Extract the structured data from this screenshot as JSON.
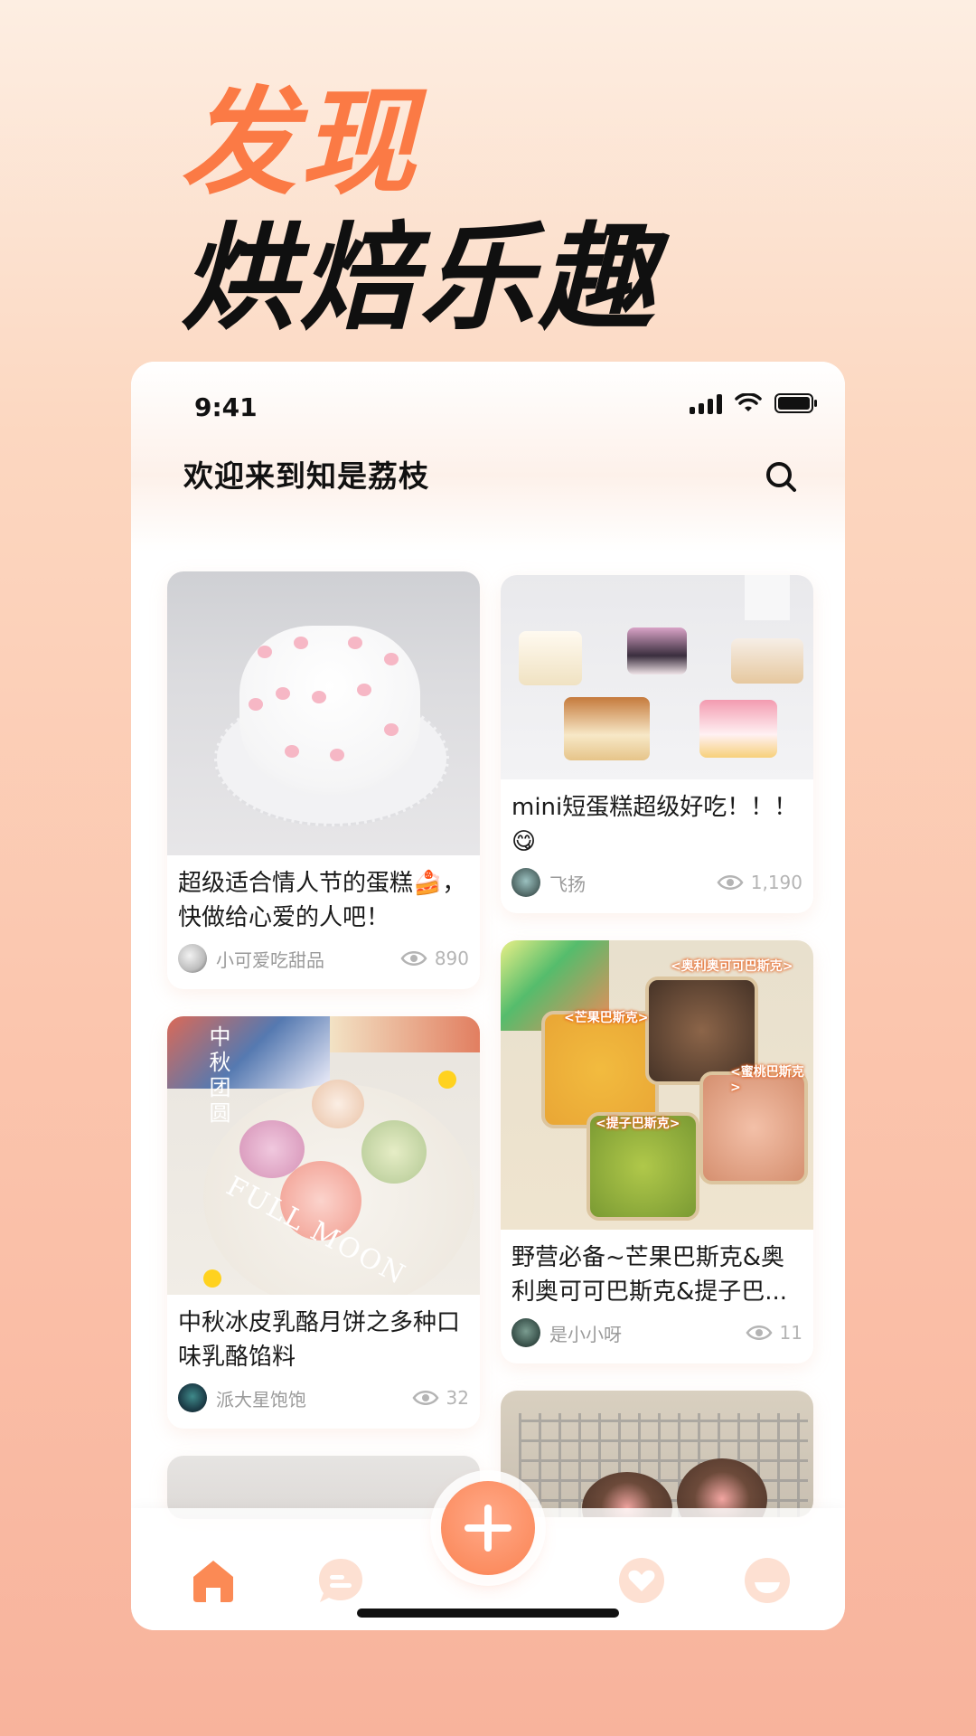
{
  "hero": {
    "line1": "发现",
    "line2": "烘焙乐趣"
  },
  "status_bar": {
    "time": "9:41"
  },
  "header": {
    "title": "欢迎来到知是荔枝",
    "search_icon": "search-icon"
  },
  "feed": {
    "left": [
      {
        "title": "超级适合情人节的蛋糕🍰，快做给心爱的人吧！",
        "author": "小可爱吃甜品",
        "views": "890",
        "image": "heart-shaped white cake"
      },
      {
        "title": "中秋冰皮乳酪月饼之多种口味乳酪馅料",
        "author": "派大星饱饱",
        "views": "32",
        "image": "mooncakes on plate",
        "image_text": {
          "vertical": "中秋团圆",
          "curve": "FULL MOON"
        }
      }
    ],
    "right": [
      {
        "title": "mini短蛋糕超级好吃！！！😋",
        "author": "飞扬",
        "views": "1,190",
        "image": "mini cake slices"
      },
      {
        "title": "野营必备~芒果巴斯克&奥利奥可可巴斯克&提子巴...",
        "author": "是小小呀",
        "views": "11",
        "image": "basque cakes in boxes",
        "image_tags": [
          "<奥利奥可可巴斯克>",
          "<芒果巴斯克>",
          "<蜜桃巴斯克>",
          "<提子巴斯克>"
        ]
      }
    ]
  },
  "tabbar": {
    "items": [
      {
        "icon": "home-icon",
        "active": true
      },
      {
        "icon": "message-icon",
        "active": false
      },
      {
        "icon": "plus-icon",
        "active": false
      },
      {
        "icon": "heart-icon",
        "active": false
      },
      {
        "icon": "profile-icon",
        "active": false
      }
    ]
  },
  "colors": {
    "accent": "#fb7a45",
    "text_primary": "#1a1a1a",
    "text_secondary": "#9a9a9a",
    "tab_inactive": "#fde2d5"
  }
}
